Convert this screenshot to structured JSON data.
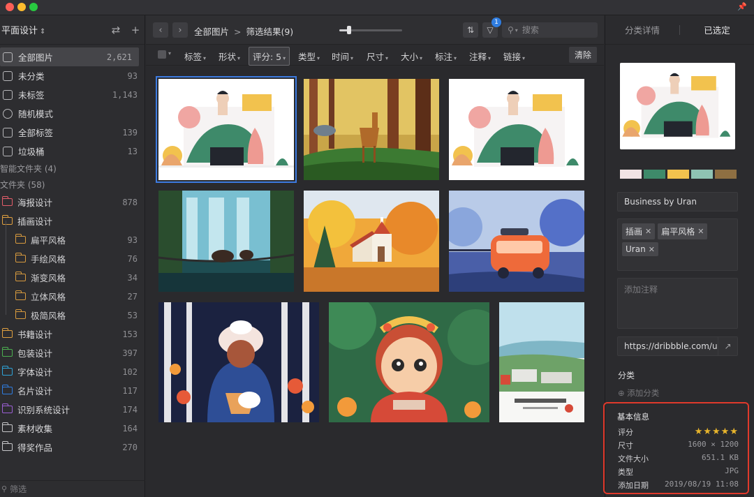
{
  "sidebar": {
    "library": "平面设计",
    "items": [
      {
        "label": "全部图片",
        "count": "2,621",
        "icon": "all-images-icon"
      },
      {
        "label": "未分类",
        "count": "93",
        "icon": "unclassified-icon"
      },
      {
        "label": "未标签",
        "count": "1,143",
        "icon": "untagged-icon"
      },
      {
        "label": "随机模式",
        "count": "",
        "icon": "random-icon"
      },
      {
        "label": "全部标签",
        "count": "139",
        "icon": "all-tags-icon"
      },
      {
        "label": "垃圾桶",
        "count": "13",
        "icon": "trash-icon"
      }
    ],
    "smart_folders_label": "智能文件夹 (4)",
    "folders_label": "文件夹 (58)",
    "folders": [
      {
        "label": "海报设计",
        "count": "878",
        "color": "#e35d6a",
        "level": 0
      },
      {
        "label": "插画设计",
        "count": "",
        "color": "#e0a040",
        "level": 0
      },
      {
        "label": "扁平风格",
        "count": "93",
        "color": "#d79a3e",
        "level": 1
      },
      {
        "label": "手绘风格",
        "count": "76",
        "color": "#d79a3e",
        "level": 1
      },
      {
        "label": "渐变风格",
        "count": "34",
        "color": "#d79a3e",
        "level": 1
      },
      {
        "label": "立体风格",
        "count": "27",
        "color": "#d79a3e",
        "level": 1
      },
      {
        "label": "极简风格",
        "count": "53",
        "color": "#d79a3e",
        "level": 1
      },
      {
        "label": "书籍设计",
        "count": "153",
        "color": "#e0a040",
        "level": 0
      },
      {
        "label": "包装设计",
        "count": "397",
        "color": "#4caf50",
        "level": 0
      },
      {
        "label": "字体设计",
        "count": "102",
        "color": "#2fa3d8",
        "level": 0
      },
      {
        "label": "名片设计",
        "count": "117",
        "color": "#2f7de1",
        "level": 0
      },
      {
        "label": "识别系统设计",
        "count": "174",
        "color": "#9c5fd6",
        "level": 0
      },
      {
        "label": "素材收集",
        "count": "164",
        "color": "#c7c7ca",
        "level": 0
      },
      {
        "label": "得奖作品",
        "count": "270",
        "color": "#c7c7ca",
        "level": 0
      }
    ],
    "filter_placeholder": "筛选"
  },
  "toolbar": {
    "crumb_root": "全部图片",
    "crumb_sep": ">",
    "crumb_current": "筛选结果(9)",
    "zoom_level": 0.15,
    "filter_badge": "1",
    "search_placeholder": "搜索"
  },
  "filterbar": {
    "items": [
      "标签",
      "形状",
      "评分: 5",
      "类型",
      "时间",
      "尺寸",
      "大小",
      "标注",
      "注释",
      "链接"
    ],
    "selected_index": 2,
    "clear_label": "清除"
  },
  "gallery": {
    "count": 9,
    "selected_index": 0
  },
  "inspector": {
    "tab_details": "分类详情",
    "tab_selected": "已选定",
    "palette": [
      "#f1e3e4",
      "#3e8a6a",
      "#f2c24e",
      "#8fc3b3",
      "#8e6f42"
    ],
    "title": "Business by Uran",
    "tags": [
      "插画",
      "扁平风格",
      "Uran"
    ],
    "note_placeholder": "添加注释",
    "url": "https://dribbble.com/uran",
    "category_title": "分类",
    "add_category": "添加分类",
    "info_title": "基本信息",
    "rating_label": "评分",
    "rating": 5,
    "size_label": "尺寸",
    "size": "1600 × 1200",
    "file_size_label": "文件大小",
    "file_size": "651.1 KB",
    "type_label": "类型",
    "type": "JPG",
    "date_label": "添加日期",
    "date": "2019/08/19 11:08"
  }
}
